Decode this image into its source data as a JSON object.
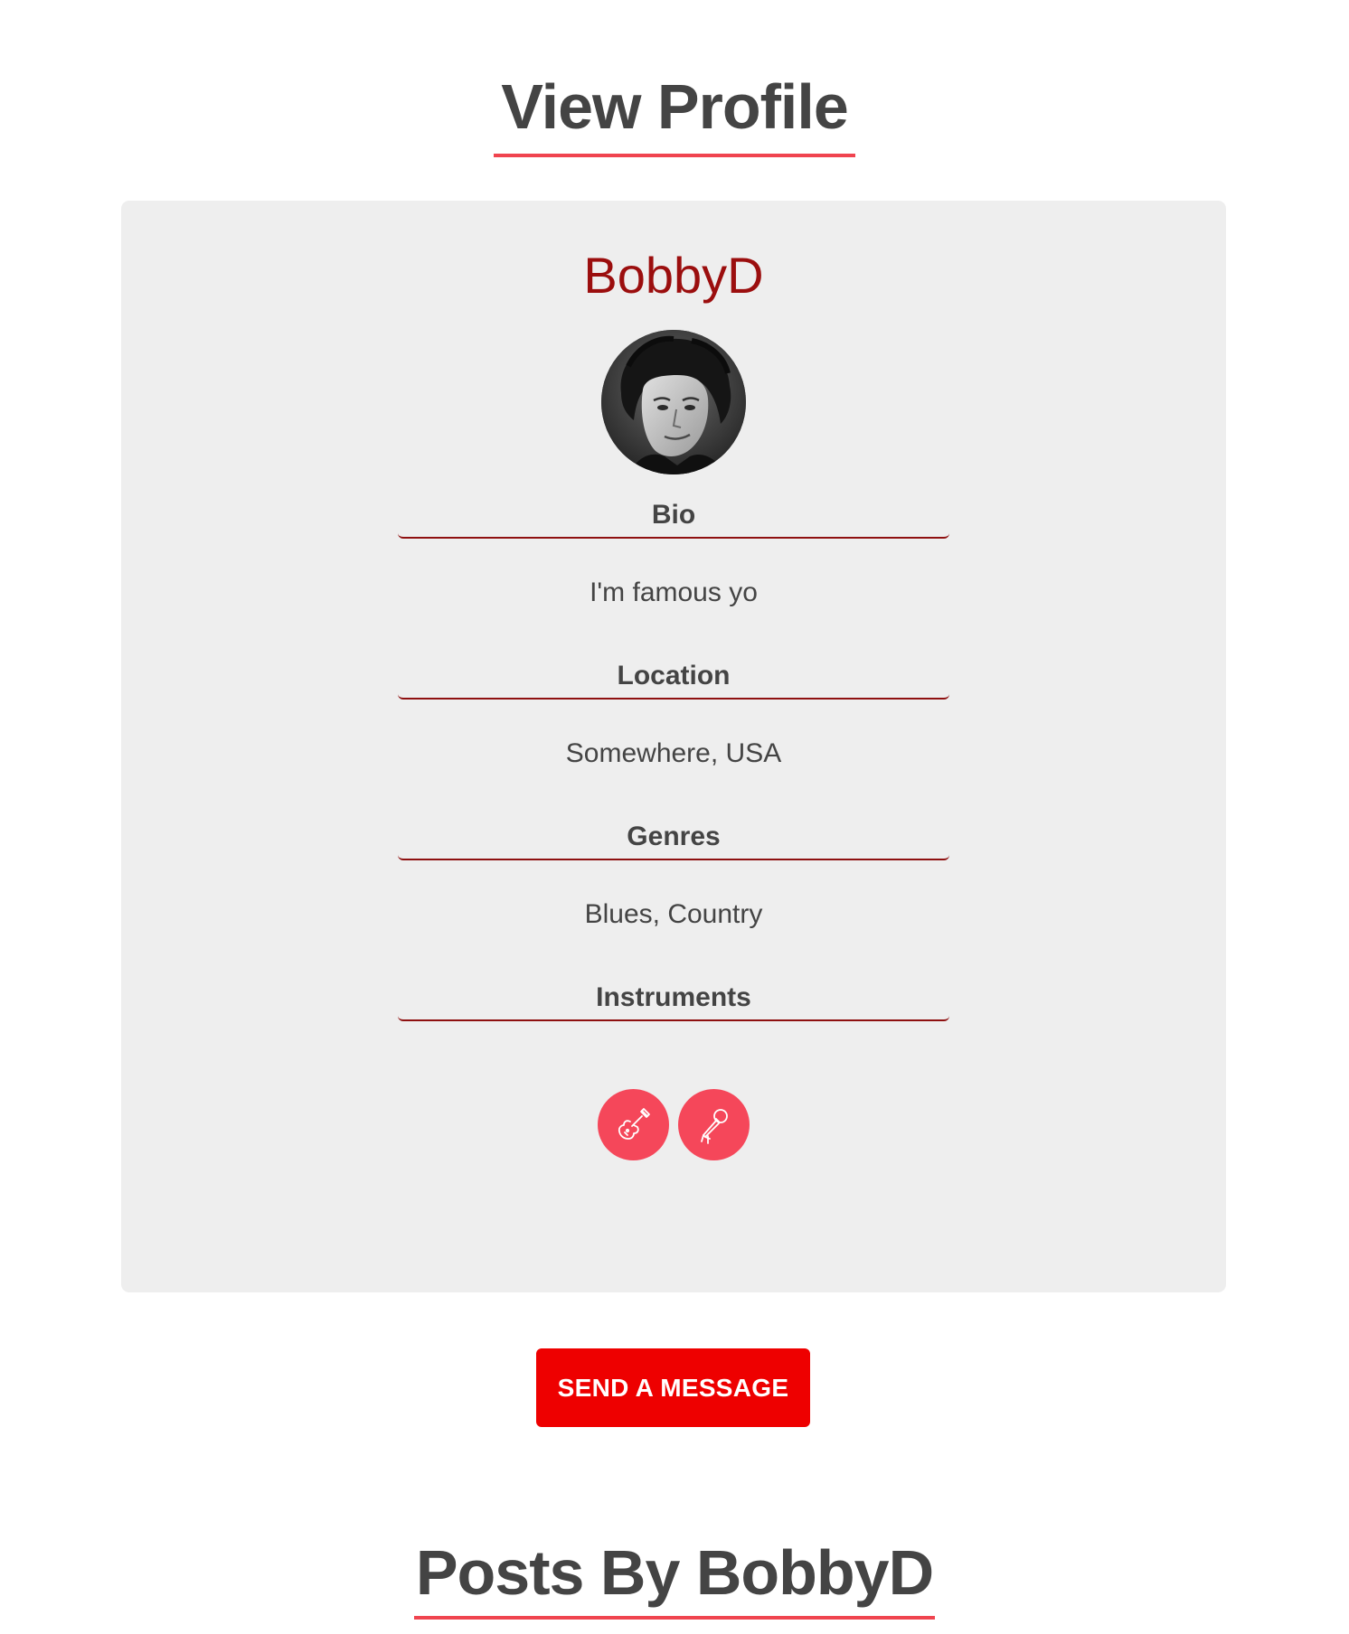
{
  "page": {
    "title": "View Profile",
    "accent_color": "#f0444f",
    "brand_red": "#ee0000"
  },
  "profile": {
    "username": "BobbyD",
    "avatar": "profile-photo",
    "bio_heading": "Bio",
    "bio": "I'm famous yo",
    "location_heading": "Location",
    "location": "Somewhere, USA",
    "genres_heading": "Genres",
    "genres": "Blues, Country",
    "instruments_heading": "Instruments",
    "instruments": [
      {
        "icon": "electric-guitar-icon"
      },
      {
        "icon": "microphone-icon"
      }
    ]
  },
  "actions": {
    "send_message_label": "SEND A MESSAGE"
  },
  "posts": {
    "title": "Posts By BobbyD"
  }
}
